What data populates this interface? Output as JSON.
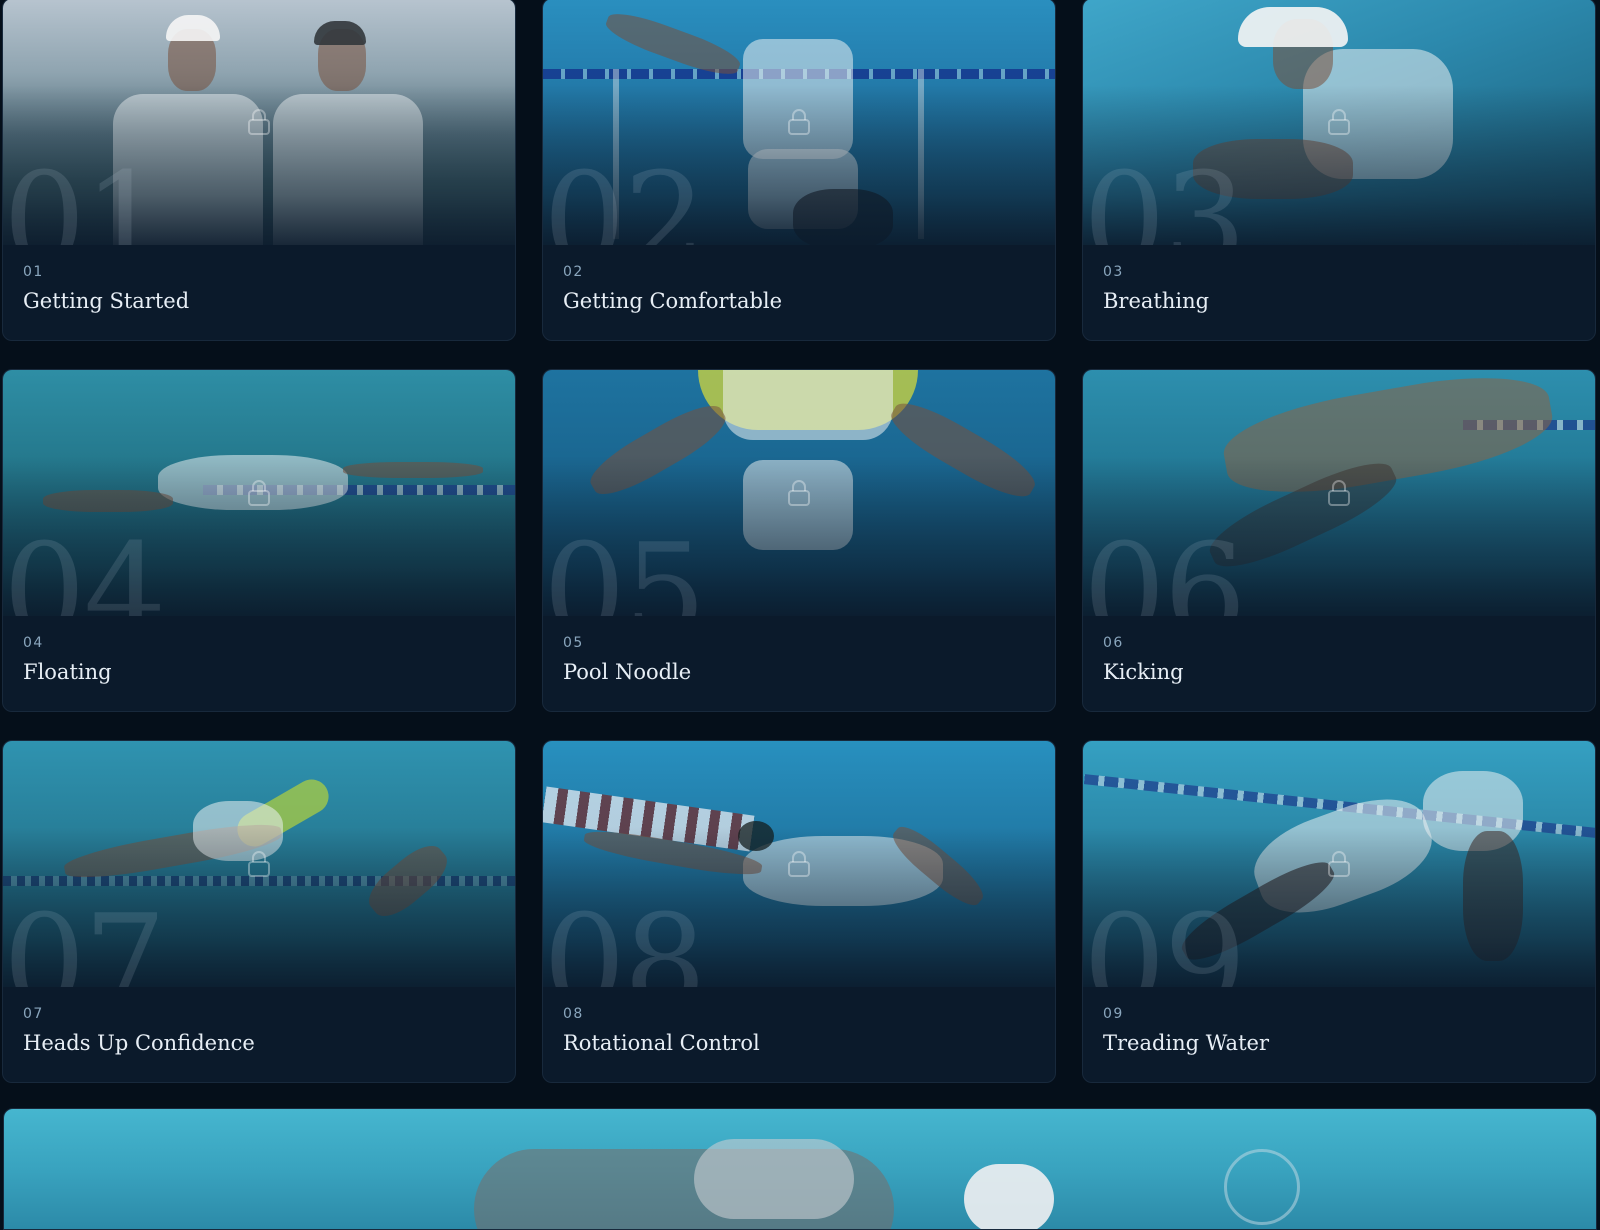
{
  "lessons": [
    {
      "number": "01",
      "big_number": "01",
      "title": "Getting Started",
      "locked": true
    },
    {
      "number": "02",
      "big_number": "02",
      "title": "Getting Comfortable",
      "locked": true
    },
    {
      "number": "03",
      "big_number": "03",
      "title": "Breathing",
      "locked": true
    },
    {
      "number": "04",
      "big_number": "04",
      "title": "Floating",
      "locked": true
    },
    {
      "number": "05",
      "big_number": "05",
      "title": "Pool Noodle",
      "locked": true
    },
    {
      "number": "06",
      "big_number": "06",
      "title": "Kicking",
      "locked": true
    },
    {
      "number": "07",
      "big_number": "07",
      "title": "Heads Up Confidence",
      "locked": true
    },
    {
      "number": "08",
      "big_number": "08",
      "title": "Rotational Control",
      "locked": true
    },
    {
      "number": "09",
      "big_number": "09",
      "title": "Treading Water",
      "locked": true
    }
  ],
  "colors": {
    "page_background": "#050f1a",
    "card_background": "#0b1a2b",
    "number_text": "#8aa6bd",
    "title_text": "#e7eef5"
  },
  "icons": {
    "lock": "lock-icon"
  }
}
